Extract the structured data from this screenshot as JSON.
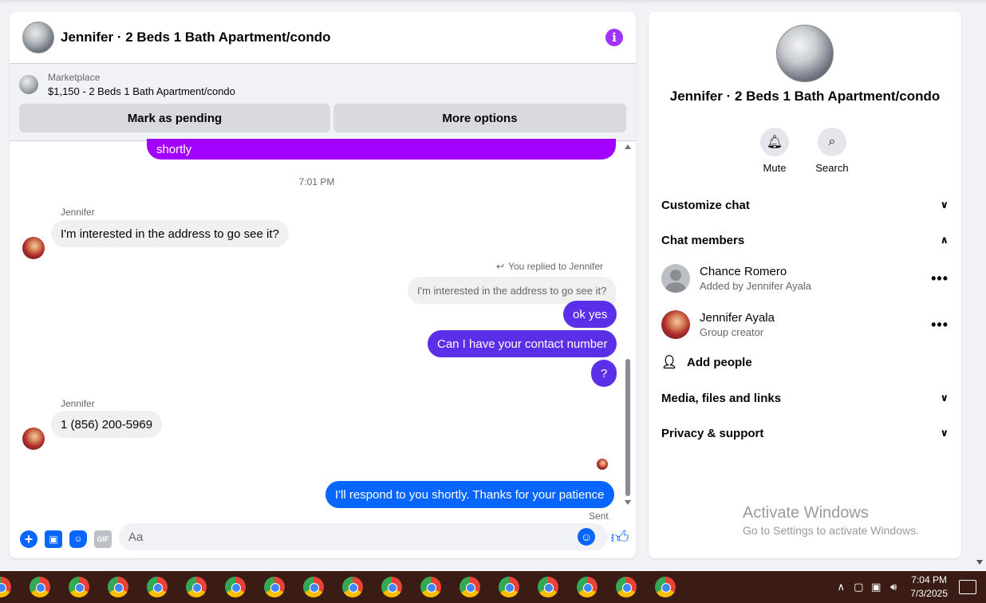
{
  "chat": {
    "title": "Jennifer · 2 Beds 1 Bath Apartment/condo",
    "marketplace_label": "Marketplace",
    "listing": "$1,150 - 2 Beds 1 Bath Apartment/condo",
    "mark_pending": "Mark as pending",
    "more_options": "More options"
  },
  "messages": {
    "top_partial": "shortly",
    "time": "7:01 PM",
    "sender1": "Jennifer",
    "in1": "I'm interested in the address to go see it?",
    "reply_note": "You replied to Jennifer",
    "quoted": "I'm interested in the address to go see it?",
    "out1": "ok yes",
    "out2": "Can I have your contact number",
    "out3": "?",
    "sender2": "Jennifer",
    "in2": "1 (856) 200-5969",
    "out4": "I'll respond to you shortly. Thanks for your patience",
    "sent": "Sent"
  },
  "composer": {
    "placeholder": "Aa",
    "gif_label": "GIF"
  },
  "side": {
    "title": "Jennifer · 2 Beds 1 Bath Apartment/condo",
    "mute": "Mute",
    "search": "Search",
    "customize": "Customize chat",
    "members": "Chat members",
    "member1_name": "Chance Romero",
    "member1_sub": "Added by Jennifer Ayala",
    "member2_name": "Jennifer Ayala",
    "member2_sub": "Group creator",
    "add_people": "Add people",
    "media": "Media, files and links",
    "privacy": "Privacy & support"
  },
  "watermark": {
    "title": "Activate Windows",
    "sub": "Go to Settings to activate Windows."
  },
  "taskbar": {
    "time": "7:04 PM",
    "date": "7/3/2025"
  },
  "colors": {
    "out_purple": "#a200ff",
    "out_indigo": "#5b2fe8",
    "out_blue": "#0866ff"
  }
}
